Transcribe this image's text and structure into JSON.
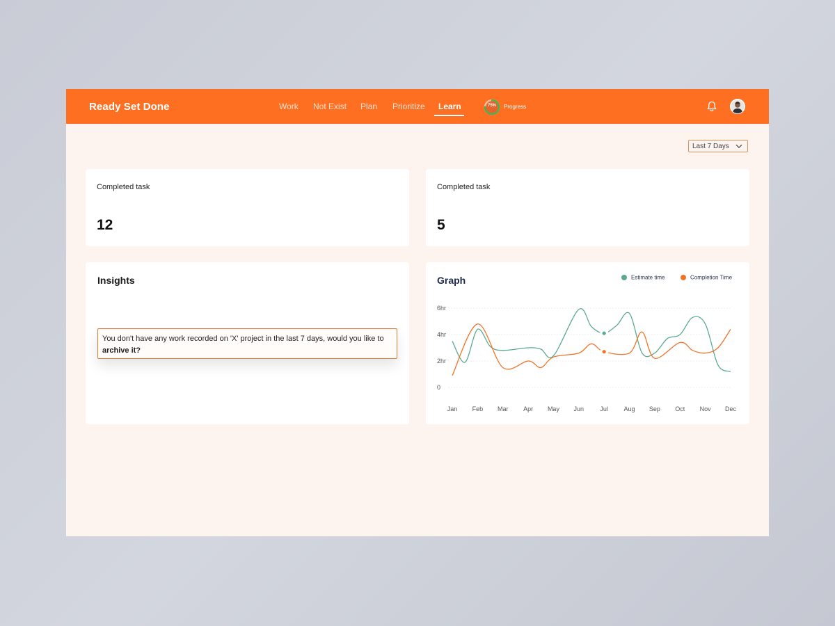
{
  "app": {
    "brand": "Ready Set Done"
  },
  "nav": {
    "items": [
      {
        "label": "Work"
      },
      {
        "label": "Not Exist"
      },
      {
        "label": "Plan"
      },
      {
        "label": "Prioritize"
      },
      {
        "label": "Learn",
        "active": true
      }
    ],
    "progress": {
      "percent_label": "75%",
      "value": 0.75,
      "label": "Progress"
    }
  },
  "header_icons": [
    "bell-icon",
    "avatar"
  ],
  "filter": {
    "selected": "Last 7 Days"
  },
  "stats": [
    {
      "label": "Completed task",
      "value": "12"
    },
    {
      "label": "Completed task",
      "value": "5"
    }
  ],
  "insights": {
    "title": "Insights",
    "message": "You don't have any work recorded on 'X' project in the last 7 days, would you like to",
    "message_bold": "archive it?"
  },
  "colors": {
    "brand": "#fe6f22",
    "estimate": "#5aa991",
    "completion": "#f07428",
    "background": "#fdf3ef"
  },
  "chart_data": {
    "type": "line",
    "title": "Graph",
    "categories": [
      "Jan",
      "Feb",
      "Mar",
      "Apr",
      "May",
      "Jun",
      "Jul",
      "Aug",
      "Sep",
      "Oct",
      "Nov",
      "Dec"
    ],
    "y_ticks": [
      "0",
      "2hr",
      "4hr",
      "6hr"
    ],
    "ylim": [
      0,
      6
    ],
    "grid": true,
    "legend": "top-right",
    "series": [
      {
        "name": "Estimate time",
        "color": "#5aa991",
        "x": [
          "Jan",
          "Jan-Feb",
          "Feb",
          "Feb-Mar",
          "Mar",
          "Apr",
          "Apr-May",
          "May",
          "Jun",
          "Jun-Jul",
          "Jul",
          "Jul-Aug",
          "Aug",
          "Aug-Sep",
          "Sep",
          "Sep-Oct",
          "Oct",
          "Oct-Nov",
          "Nov",
          "Nov-Dec",
          "Dec"
        ],
        "values": [
          3.5,
          1.9,
          4.4,
          3.1,
          2.8,
          3.0,
          2.9,
          2.4,
          5.9,
          4.6,
          4.1,
          4.7,
          5.6,
          2.6,
          2.6,
          3.7,
          4.0,
          5.3,
          4.8,
          1.7,
          1.2
        ]
      },
      {
        "name": "Completion Time",
        "color": "#f07428",
        "x": [
          "Jan",
          "Feb",
          "Mar",
          "Apr",
          "Apr-May",
          "May",
          "Jun",
          "Jun-Jul",
          "Jul",
          "Aug",
          "Aug-Sep",
          "Sep",
          "Oct",
          "Oct-Nov",
          "Nov",
          "Nov-Dec",
          "Dec"
        ],
        "values": [
          0.9,
          4.8,
          1.5,
          2.0,
          1.5,
          2.3,
          2.6,
          3.3,
          2.7,
          2.6,
          4.2,
          2.2,
          3.4,
          2.8,
          2.6,
          3.0,
          4.4
        ]
      }
    ],
    "highlight": {
      "category": "Jul",
      "estimate": 4.1,
      "completion": 2.7
    }
  }
}
